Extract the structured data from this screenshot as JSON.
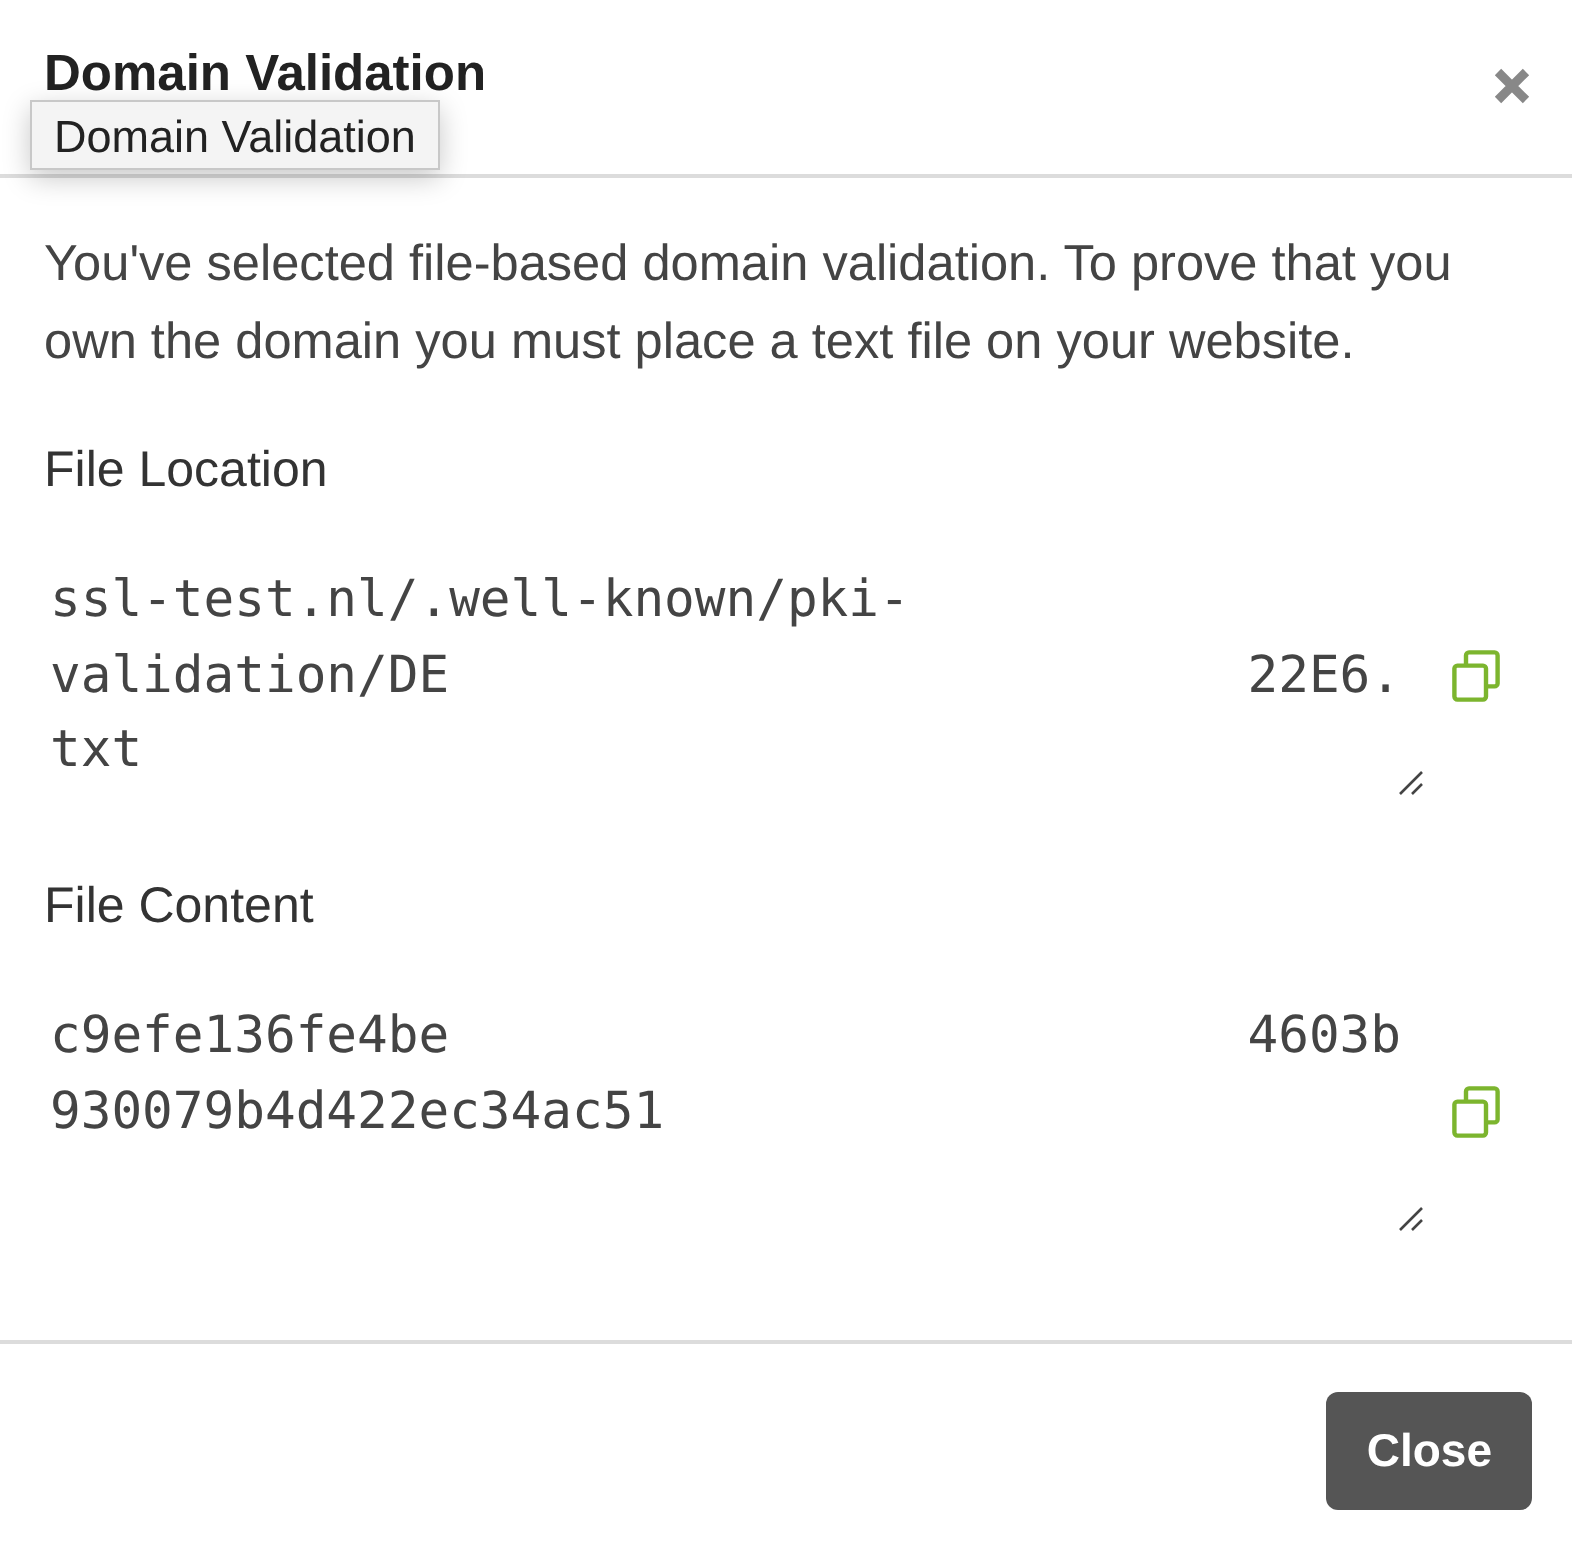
{
  "dialog": {
    "title": "Domain Validation"
  },
  "tooltip": {
    "text": "Domain Validation"
  },
  "description": "You've selected file-based domain validation. To prove that you own the domain you must place a text file on your website.",
  "fields": [
    {
      "label": "File Location",
      "lines": [
        [
          {
            "kind": "text",
            "text": "ssl-test.nl/.well-known/pki-"
          }
        ],
        [
          {
            "kind": "text",
            "text": "validation/DE"
          },
          {
            "kind": "redacted"
          },
          {
            "kind": "text",
            "text": "22E6."
          }
        ],
        [
          {
            "kind": "text",
            "text": "txt"
          }
        ]
      ]
    },
    {
      "label": "File Content",
      "lines": [
        [
          {
            "kind": "text",
            "text": "c9efe136fe4be"
          },
          {
            "kind": "redacted"
          },
          {
            "kind": "text",
            "text": "4603b"
          }
        ],
        [
          {
            "kind": "text",
            "text": "930079b4d422ec34ac51"
          }
        ]
      ]
    }
  ],
  "footer": {
    "buttons": [
      {
        "label": "Close"
      }
    ]
  }
}
